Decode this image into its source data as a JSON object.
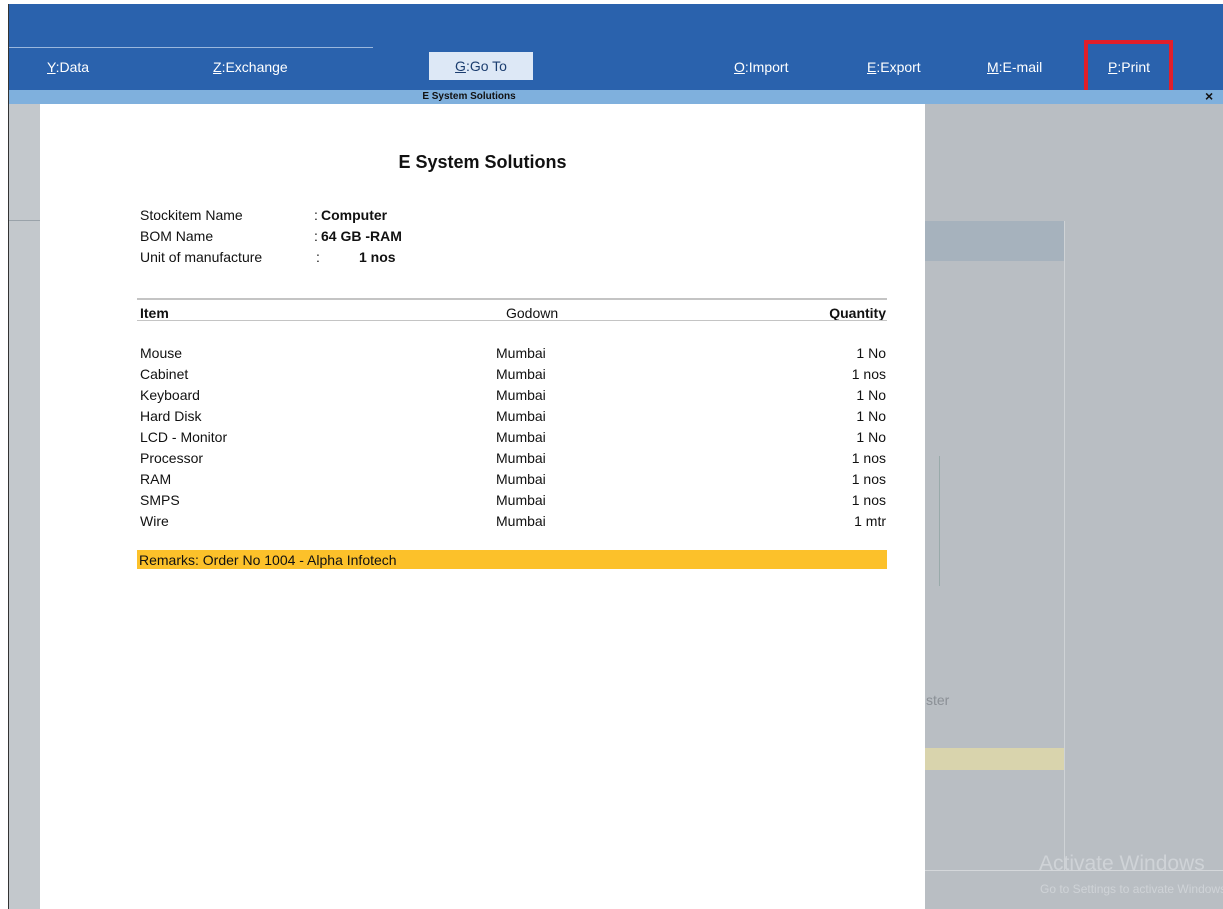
{
  "menu": {
    "data": {
      "key": "Y",
      "label": ":Data"
    },
    "exchange": {
      "key": "Z",
      "label": ":Exchange"
    },
    "goto": {
      "key": "G",
      "label": ":Go To"
    },
    "import": {
      "key": "O",
      "label": ":Import"
    },
    "export": {
      "key": "E",
      "label": ":Export"
    },
    "email": {
      "key": "M",
      "label": ":E-mail"
    },
    "print": {
      "key": "P",
      "label": ":Print"
    }
  },
  "window": {
    "title": "E System Solutions",
    "close": "×"
  },
  "report": {
    "company": "E System Solutions",
    "info": [
      {
        "label": "Stockitem Name",
        "value": "Computer"
      },
      {
        "label": "BOM Name",
        "value": "64 GB -RAM"
      },
      {
        "label": "Unit of manufacture",
        "value": "1 nos"
      }
    ],
    "colon": ":",
    "columns": {
      "item": "Item",
      "godown": "Godown",
      "quantity": "Quantity"
    },
    "rows": [
      {
        "item": "Mouse",
        "godown": "Mumbai",
        "quantity": "1 No"
      },
      {
        "item": "Cabinet",
        "godown": "Mumbai",
        "quantity": "1 nos"
      },
      {
        "item": "Keyboard",
        "godown": "Mumbai",
        "quantity": "1 No"
      },
      {
        "item": "Hard Disk",
        "godown": "Mumbai",
        "quantity": "1 No"
      },
      {
        "item": "LCD - Monitor",
        "godown": "Mumbai",
        "quantity": "1 No"
      },
      {
        "item": "Processor",
        "godown": "Mumbai",
        "quantity": "1 nos"
      },
      {
        "item": "RAM",
        "godown": "Mumbai",
        "quantity": "1 nos"
      },
      {
        "item": "SMPS",
        "godown": "Mumbai",
        "quantity": "1 nos"
      },
      {
        "item": "Wire",
        "godown": "Mumbai",
        "quantity": "1 mtr"
      }
    ],
    "remarks": "Remarks: Order No 1004 - Alpha Infotech"
  },
  "background": {
    "partial_text": "ster"
  },
  "watermark": {
    "title": "Activate Windows",
    "subtitle": "Go to Settings to activate Windows."
  },
  "colors": {
    "topbar": "#2a62ad",
    "subbar": "#7fb0dd",
    "highlight": "#e11f2a",
    "remarks": "#fcc12a"
  }
}
